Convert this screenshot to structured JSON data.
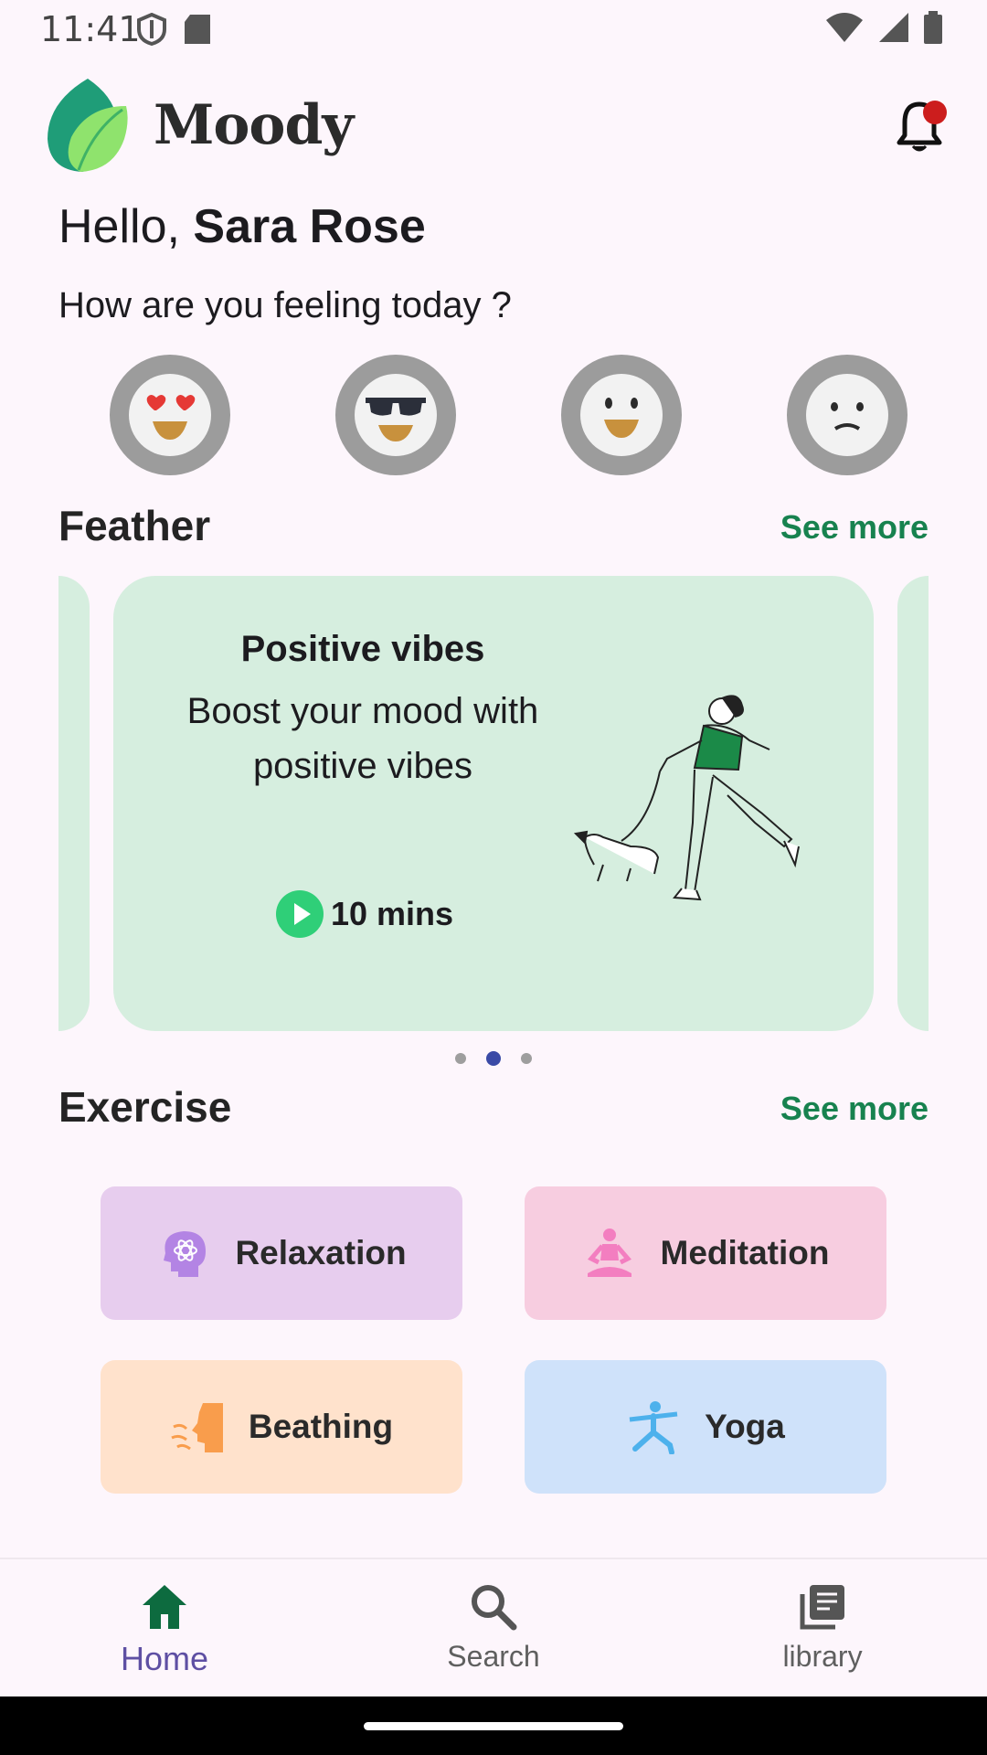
{
  "status_bar": {
    "time": "11:41"
  },
  "header": {
    "app_name": "Moody"
  },
  "greeting": {
    "prefix": "Hello, ",
    "name": "Sara Rose"
  },
  "mood_prompt": "How are you feeling today ?",
  "moods": [
    "heart-eyes-icon",
    "sunglasses-icon",
    "smile-icon",
    "sad-icon"
  ],
  "feather": {
    "title": "Feather",
    "see_more": "See more",
    "card": {
      "title": "Positive vibes",
      "description": "Boost your mood with positive vibes",
      "duration": "10 mins"
    }
  },
  "exercise": {
    "title": "Exercise",
    "see_more": "See more",
    "tiles": [
      {
        "label": "Relaxation",
        "color": "#e7cdee",
        "icon": "brain-atom-icon"
      },
      {
        "label": "Meditation",
        "color": "#f7cde0",
        "icon": "meditation-icon"
      },
      {
        "label": "Beathing",
        "color": "#ffe2cc",
        "icon": "breathing-icon"
      },
      {
        "label": "Yoga",
        "color": "#cfe2fa",
        "icon": "yoga-icon"
      }
    ]
  },
  "bottom_nav": [
    {
      "label": "Home",
      "icon": "home-icon",
      "active": true
    },
    {
      "label": "Search",
      "icon": "search-icon",
      "active": false
    },
    {
      "label": "library",
      "icon": "library-icon",
      "active": false
    }
  ],
  "colors": {
    "accent": "#17824f",
    "card": "#d6eedf",
    "nav_active": "#5e4fa3"
  }
}
